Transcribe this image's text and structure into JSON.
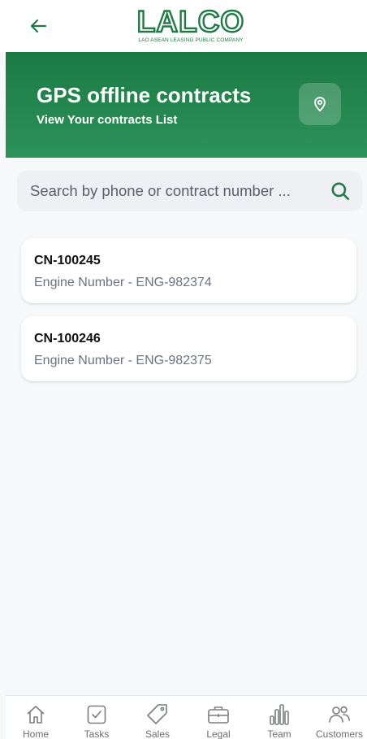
{
  "header": {
    "logo_text": "LALCO",
    "logo_tagline": "LAO ASEAN LEASING PUBLIC COMPANY",
    "back_icon": "arrow-left-icon"
  },
  "banner": {
    "title": "GPS offline contracts",
    "subtitle": "View Your contracts List",
    "action_icon": "map-pin-icon"
  },
  "search": {
    "placeholder": "Search by phone or contract number ...",
    "value": "",
    "icon": "search-icon"
  },
  "contracts": [
    {
      "id": "CN-100245",
      "detail": "Engine Number - ENG-982374"
    },
    {
      "id": "CN-100246",
      "detail": "Engine Number - ENG-982375"
    }
  ],
  "nav": {
    "items": [
      {
        "label": "Home",
        "icon": "home-icon"
      },
      {
        "label": "Tasks",
        "icon": "checkbox-icon"
      },
      {
        "label": "Sales",
        "icon": "tag-icon"
      },
      {
        "label": "Legal",
        "icon": "briefcase-icon"
      },
      {
        "label": "Team",
        "icon": "bar-chart-icon"
      },
      {
        "label": "Customers",
        "icon": "users-icon"
      }
    ]
  },
  "colors": {
    "brand_green": "#1f7a45",
    "banner_green": "#1b7a43",
    "search_bg": "#eef0f3"
  }
}
